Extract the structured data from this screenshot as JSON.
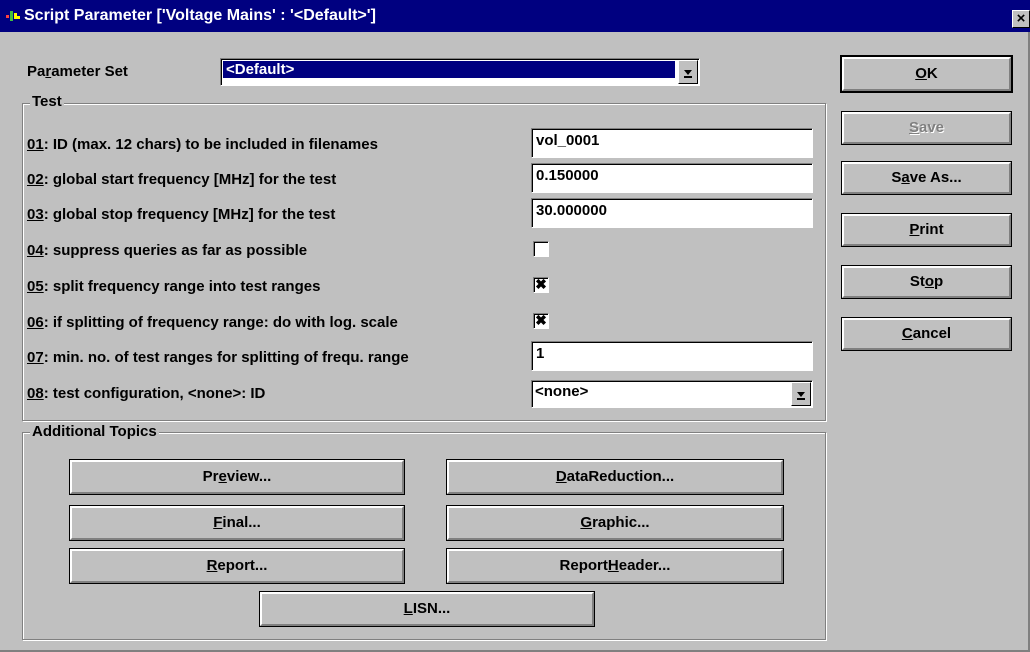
{
  "window": {
    "title": "Script Parameter ['Voltage Mains' : '<Default>']",
    "close_glyph": "×"
  },
  "parameter_set": {
    "label_pre": "Pa",
    "label_mn": "r",
    "label_post": "ameter Set",
    "value": "<Default>"
  },
  "test_group": {
    "title": "Test",
    "params": [
      {
        "num": "01",
        "text": ": ID (max. 12 chars) to be included in filenames",
        "type": "text",
        "value": "vol_0001"
      },
      {
        "num": "02",
        "text": ": global start frequency [MHz] for the test",
        "type": "text",
        "value": "0.150000"
      },
      {
        "num": "03",
        "text": ": global stop frequency [MHz] for the test",
        "type": "text",
        "value": "30.000000"
      },
      {
        "num": "04",
        "text": ": suppress queries as far as possible",
        "type": "checkbox",
        "checked": false,
        "mark": ""
      },
      {
        "num": "05",
        "text": ": split frequency range into test ranges",
        "type": "checkbox",
        "checked": true,
        "mark": "✖"
      },
      {
        "num": "06",
        "text": ": if splitting of frequency range: do with log. scale",
        "type": "checkbox",
        "checked": true,
        "mark": "✖"
      },
      {
        "num": "07",
        "text": ": min. no. of test ranges for splitting of frequ. range",
        "type": "text",
        "value": "1"
      },
      {
        "num": "08",
        "text": ": test configuration, <none>: ID",
        "type": "combo",
        "value": "<none>"
      }
    ]
  },
  "additional_topics": {
    "title": "Additional Topics",
    "buttons": {
      "preview": {
        "pre": "Pr",
        "mn": "e",
        "post": "view..."
      },
      "datared": {
        "pre": "",
        "mn": "D",
        "post": "ataReduction..."
      },
      "final": {
        "pre": "",
        "mn": "F",
        "post": "inal..."
      },
      "graphic": {
        "pre": "",
        "mn": "G",
        "post": "raphic..."
      },
      "report": {
        "pre": "",
        "mn": "R",
        "post": "eport..."
      },
      "rheader": {
        "pre": "Report",
        "mn": "H",
        "post": "eader..."
      },
      "lisn": {
        "pre": "",
        "mn": "L",
        "post": "ISN..."
      }
    }
  },
  "actions": {
    "ok": {
      "pre": "",
      "mn": "O",
      "post": "K",
      "enabled": true
    },
    "save": {
      "pre": "",
      "mn": "S",
      "post": "ave",
      "enabled": false
    },
    "saveas": {
      "pre": "S",
      "mn": "a",
      "post": "ve As...",
      "enabled": true
    },
    "print": {
      "pre": "",
      "mn": "P",
      "post": "rint",
      "enabled": true
    },
    "stop": {
      "pre": "St",
      "mn": "o",
      "post": "p",
      "enabled": true
    },
    "cancel": {
      "pre": "",
      "mn": "C",
      "post": "ancel",
      "enabled": true
    }
  },
  "colors": {
    "titlebar": "#000080",
    "face": "#c0c0c0",
    "selection": "#000080"
  }
}
